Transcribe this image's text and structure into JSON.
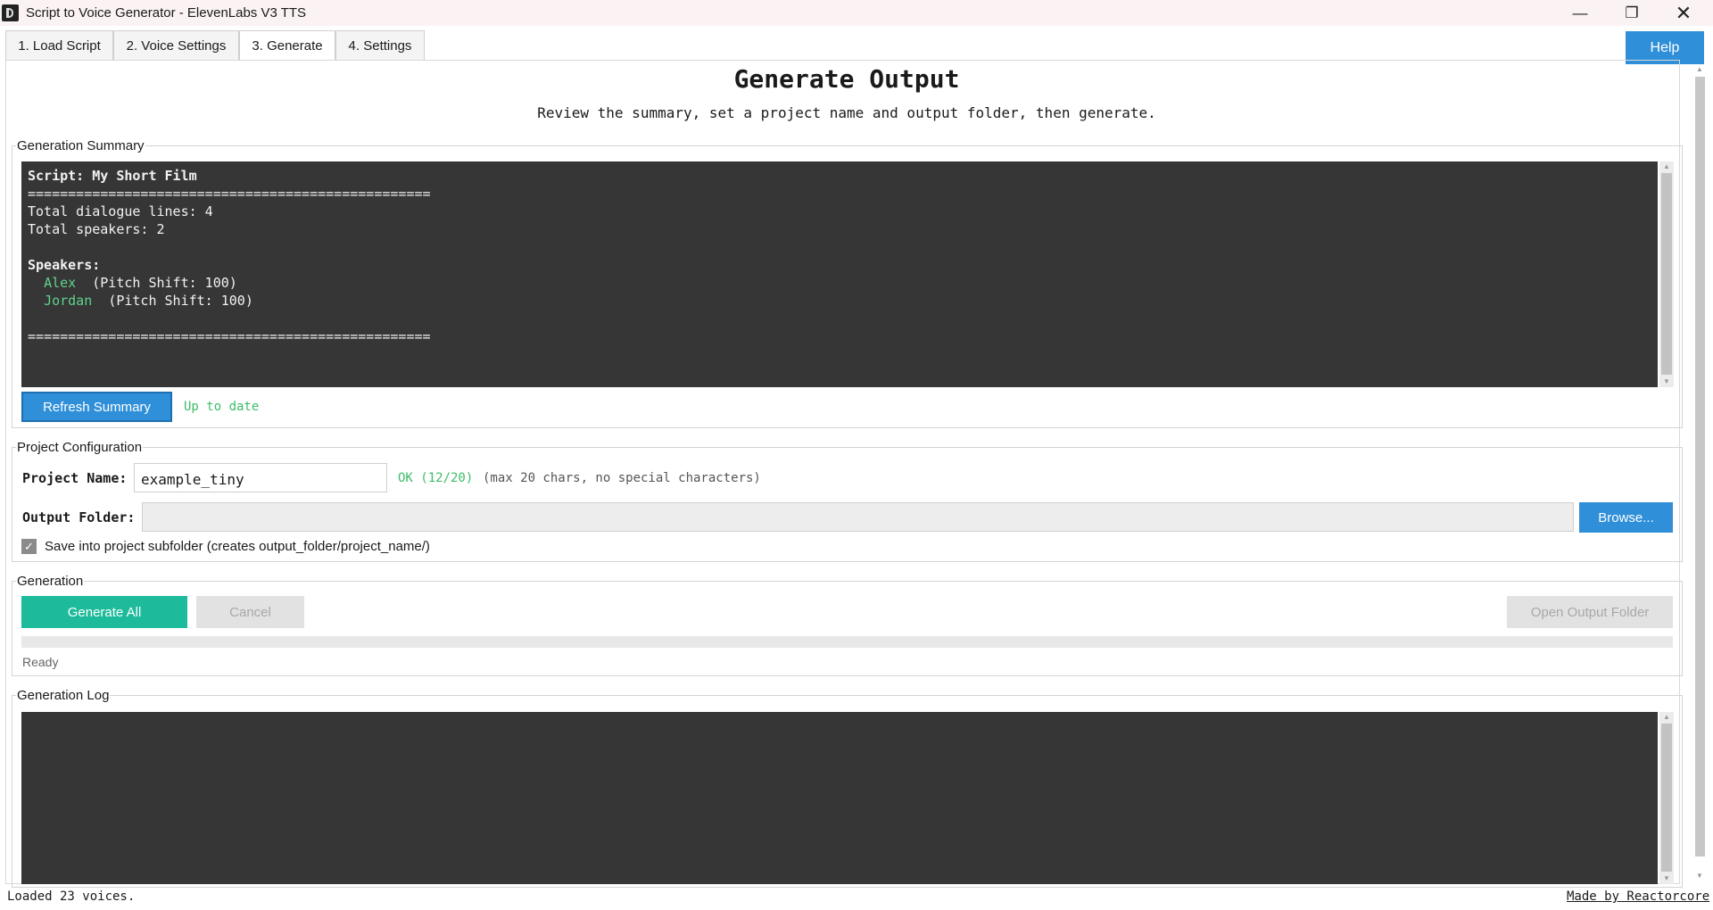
{
  "window": {
    "title": "Script to Voice Generator - ElevenLabs V3 TTS",
    "minimize_icon": "minimize-icon",
    "maximize_icon": "restore-icon",
    "close_icon": "close-icon"
  },
  "tabs": [
    {
      "label": "1. Load Script"
    },
    {
      "label": "2. Voice Settings"
    },
    {
      "label": "3. Generate",
      "active": true
    },
    {
      "label": "4. Settings"
    }
  ],
  "help_label": "Help",
  "header": {
    "title": "Generate Output",
    "subtitle": "Review the summary, set a project name and output folder, then generate."
  },
  "summary": {
    "legend": "Generation Summary",
    "script_line": "Script: My Short Film",
    "separator": "==================================================",
    "total_lines": "Total dialogue lines: 4",
    "total_speakers": "Total speakers: 2",
    "speakers_heading": "Speakers:",
    "speakers": [
      {
        "name": "Alex",
        "detail": "(Pitch Shift: 100)"
      },
      {
        "name": "Jordan",
        "detail": "(Pitch Shift: 100)"
      }
    ],
    "refresh_label": "Refresh Summary",
    "status": "Up to date"
  },
  "project": {
    "legend": "Project Configuration",
    "name_label": "Project Name:",
    "name_value": "example_tiny",
    "name_status": "OK (12/20)",
    "name_hint": "(max 20 chars, no special characters)",
    "folder_label": "Output Folder:",
    "folder_value": "",
    "browse_label": "Browse...",
    "subfolder_checked": true,
    "subfolder_label": "Save into project subfolder",
    "subfolder_hint": "(creates  output_folder/project_name/)"
  },
  "generation": {
    "legend": "Generation",
    "generate_label": "Generate All",
    "cancel_label": "Cancel",
    "open_folder_label": "Open Output Folder",
    "progress": 0,
    "status": "Ready"
  },
  "log": {
    "legend": "Generation Log"
  },
  "statusbar": {
    "left": "Loaded 23 voices.",
    "right": "Made by Reactorcore"
  },
  "colors": {
    "accent_blue": "#2f8fd8",
    "generate_teal": "#1dbb9b",
    "ok_green": "#3dbd68",
    "console_bg": "#363636"
  }
}
